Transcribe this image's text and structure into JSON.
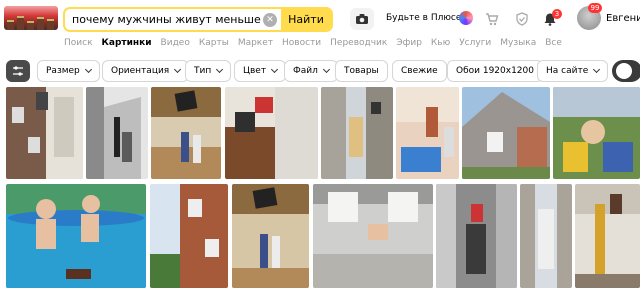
{
  "search": {
    "query": "почему мужчины живут меньше чем >",
    "button_label": "Найти"
  },
  "header": {
    "plus_label": "Будьте в Плюсе",
    "notifications_count": "3",
    "avatar_count": "99",
    "user_name": "Евгения"
  },
  "services": [
    "Поиск",
    "Картинки",
    "Видео",
    "Карты",
    "Маркет",
    "Новости",
    "Переводчик",
    "Эфир",
    "Кью",
    "Услуги",
    "Музыка",
    "Все"
  ],
  "active_service": "Картинки",
  "filters": [
    "Размер",
    "Ориентация",
    "Тип",
    "Цвет",
    "Файл",
    "Товары",
    "Свежие",
    "Обои 1920x1200",
    "На сайте"
  ],
  "colors": {
    "accent": "#ffdb4d",
    "badge": "#ff3333"
  }
}
